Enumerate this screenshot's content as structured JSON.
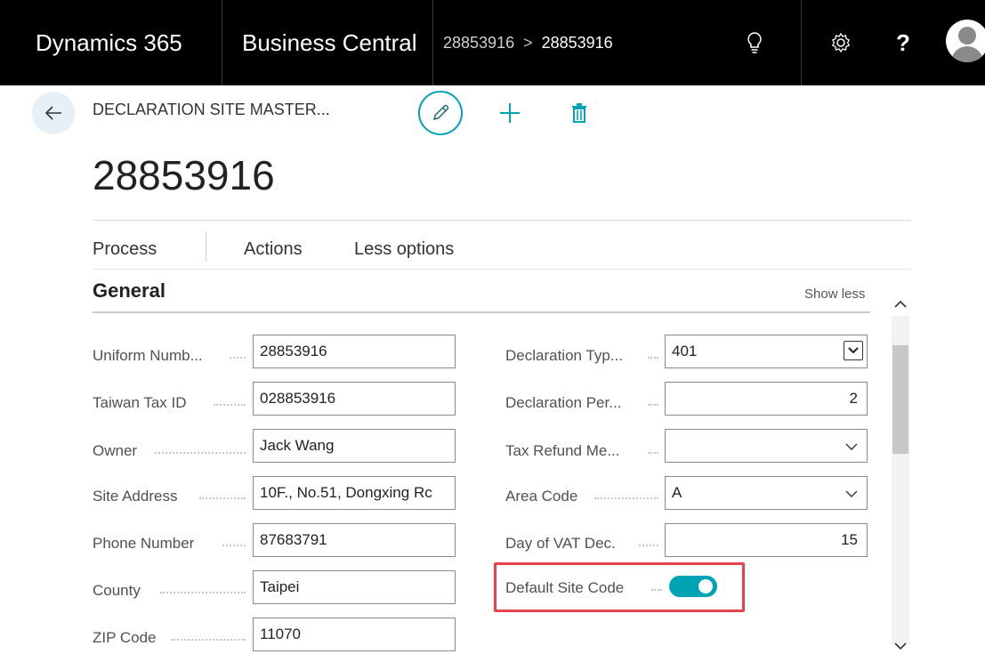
{
  "topbar": {
    "product": "Dynamics 365",
    "app": "Business Central",
    "breadcrumb_parent": "28853916",
    "breadcrumb_separator": ">",
    "breadcrumb_current": "28853916",
    "help_label": "?",
    "icons": [
      "lightbulb-icon",
      "settings-icon",
      "help-icon",
      "avatar-icon"
    ]
  },
  "header": {
    "caption": "DECLARATION SITE MASTER...",
    "title": "28853916",
    "accent_color": "#00a3b4"
  },
  "menu": {
    "items": [
      "Process",
      "Actions",
      "Less options"
    ]
  },
  "section": {
    "title": "General",
    "toggle_label": "Show less"
  },
  "left_fields": [
    {
      "label": "Uniform Numb...",
      "value": "28853916"
    },
    {
      "label": "Taiwan Tax ID",
      "value": "028853916"
    },
    {
      "label": "Owner",
      "value": "Jack Wang"
    },
    {
      "label": "Site Address",
      "value": "10F., No.51, Dongxing Rc"
    },
    {
      "label": "Phone Number",
      "value": "87683791"
    },
    {
      "label": "County",
      "value": "Taipei"
    },
    {
      "label": "ZIP Code",
      "value": "11070"
    }
  ],
  "right_fields": [
    {
      "label": "Declaration Typ...",
      "value": "401",
      "type": "select"
    },
    {
      "label": "Declaration Per...",
      "value": "2",
      "type": "number"
    },
    {
      "label": "Tax Refund Me...",
      "value": "",
      "type": "dropdown"
    },
    {
      "label": "Area Code",
      "value": "A",
      "type": "dropdown"
    },
    {
      "label": "Day of VAT Dec.",
      "value": "15",
      "type": "number"
    },
    {
      "label": "Default Site Code",
      "value": "On",
      "type": "toggle"
    }
  ],
  "highlight_color": "#e8414b"
}
